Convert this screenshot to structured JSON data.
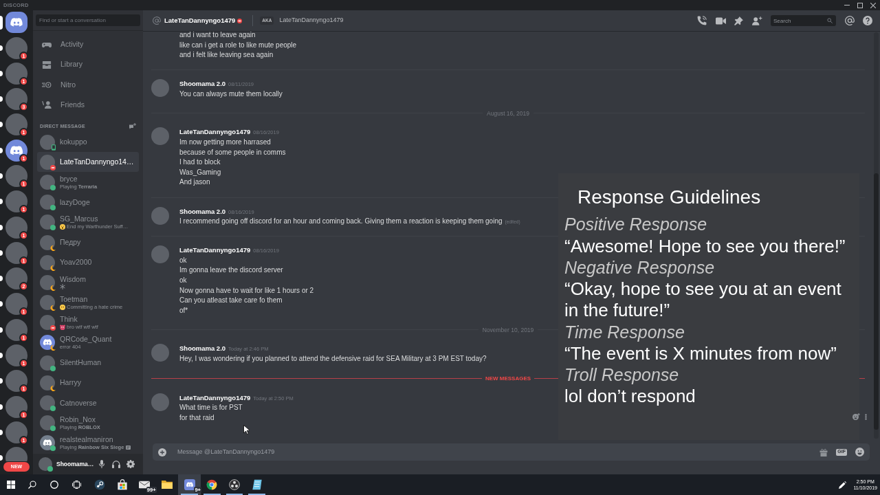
{
  "title_bar": {
    "title": "DISCORD"
  },
  "home": {
    "selected": true
  },
  "servers": [
    {
      "avatar": {
        "kind": "photo"
      },
      "badge": "1",
      "unread": true,
      "selected": false
    },
    {
      "avatar": {
        "kind": "photo"
      },
      "badge": "1",
      "unread": true,
      "selected": false
    },
    {
      "avatar": {
        "kind": "photo"
      },
      "badge": "3",
      "unread": true,
      "selected": false
    },
    {
      "avatar": {
        "kind": "photo"
      },
      "badge": "1",
      "unread": true,
      "selected": false
    },
    {
      "avatar": {
        "kind": "default",
        "color": "#7289da"
      },
      "badge": "1",
      "unread": true,
      "selected": false
    },
    {
      "avatar": {
        "kind": "photo"
      },
      "badge": "1",
      "unread": true,
      "selected": false
    },
    {
      "avatar": {
        "kind": "photo"
      },
      "badge": "1",
      "unread": true,
      "selected": false
    },
    {
      "avatar": {
        "kind": "photo"
      },
      "badge": "1",
      "unread": true,
      "selected": false
    },
    {
      "avatar": {
        "kind": "photo"
      },
      "badge": "1",
      "unread": true,
      "selected": false
    },
    {
      "avatar": {
        "kind": "photo"
      },
      "badge": "2",
      "unread": true,
      "selected": false
    },
    {
      "avatar": {
        "kind": "photo"
      },
      "badge": "1",
      "unread": true,
      "selected": false
    },
    {
      "avatar": {
        "kind": "photo"
      },
      "badge": "1",
      "unread": true,
      "selected": false
    },
    {
      "avatar": {
        "kind": "photo"
      },
      "badge": "1",
      "unread": true,
      "selected": false
    },
    {
      "avatar": {
        "kind": "photo"
      },
      "badge": "1",
      "unread": true,
      "selected": false
    },
    {
      "avatar": {
        "kind": "photo"
      },
      "badge": "1",
      "unread": true,
      "selected": false
    },
    {
      "avatar": {
        "kind": "photo"
      },
      "badge": "1",
      "unread": true,
      "selected": false
    },
    {
      "avatar": {
        "kind": "photo"
      },
      "unread": true,
      "selected": false
    }
  ],
  "new_pill": "NEW",
  "sidebar": {
    "search": {
      "placeholder": "Find or start a conversation"
    },
    "nav": [
      {
        "label": "Activity"
      },
      {
        "label": "Library"
      },
      {
        "label": "Nitro"
      },
      {
        "label": "Friends"
      }
    ],
    "section_title": "DIRECT MESSAGE",
    "conversations": [
      {
        "name": "kokuppo",
        "avatar": {
          "kind": "photo"
        },
        "status": {
          "kind": "mobile"
        },
        "selected": false,
        "rich_presence": false
      },
      {
        "name": "LateTanDannyngo14…",
        "avatar": {
          "kind": "photo"
        },
        "status": {
          "kind": "dnd"
        },
        "selected": true,
        "rich_presence": false
      },
      {
        "name": "bryce",
        "activity": "Playing **Terraria**",
        "avatar": {
          "kind": "photo"
        },
        "status": {
          "kind": "online"
        },
        "selected": false,
        "rich_presence": false
      },
      {
        "name": "lazyDoge",
        "avatar": {
          "kind": "photo"
        },
        "status": {
          "kind": "online"
        },
        "selected": false,
        "rich_presence": false
      },
      {
        "name": "SG_Marcus",
        "emoji": {
          "kind": "scream"
        },
        "activity": "End my Warthunder Suff…",
        "avatar": {
          "kind": "photo"
        },
        "status": {
          "kind": "online"
        },
        "selected": false,
        "rich_presence": false
      },
      {
        "name": "Педру",
        "avatar": {
          "kind": "photo"
        },
        "status": {
          "kind": "idle"
        },
        "selected": false,
        "rich_presence": false
      },
      {
        "name": "Yoav2000",
        "avatar": {
          "kind": "photo"
        },
        "status": {
          "kind": "idle"
        },
        "selected": false,
        "rich_presence": false
      },
      {
        "name": "Wisdom",
        "emoji": {
          "kind": "snowflake"
        },
        "avatar": {
          "kind": "photo"
        },
        "status": {
          "kind": "idle"
        },
        "selected": false,
        "rich_presence": false
      },
      {
        "name": "Toetman",
        "emoji": {
          "kind": "blank-face"
        },
        "activity": "Committing a hate crime",
        "avatar": {
          "kind": "photo"
        },
        "status": {
          "kind": "idle"
        },
        "selected": false,
        "rich_presence": false
      },
      {
        "name": "Think",
        "emoji": {
          "kind": "monkey"
        },
        "activity": "bro wtf wtf wtf",
        "avatar": {
          "kind": "photo"
        },
        "status": {
          "kind": "dnd"
        },
        "selected": false,
        "rich_presence": false
      },
      {
        "name": "QRCode_Quant",
        "activity": "error 404",
        "avatar": {
          "kind": "default",
          "color": "#7289da"
        },
        "status": {
          "kind": "idle"
        },
        "selected": false,
        "rich_presence": false
      },
      {
        "name": "SilentHuman",
        "avatar": {
          "kind": "photo"
        },
        "status": {
          "kind": "online"
        },
        "selected": false,
        "rich_presence": false
      },
      {
        "name": "Harryy",
        "avatar": {
          "kind": "photo"
        },
        "status": {
          "kind": "idle"
        },
        "selected": false,
        "rich_presence": false
      },
      {
        "name": "Catnoverse",
        "avatar": {
          "kind": "photo"
        },
        "status": {
          "kind": "online"
        },
        "selected": false,
        "rich_presence": false
      },
      {
        "name": "Robin_Nox",
        "activity": "Playing **ROBLOX**",
        "avatar": {
          "kind": "photo"
        },
        "status": {
          "kind": "online"
        },
        "selected": false,
        "rich_presence": false
      },
      {
        "name": "realstealmaniron",
        "activity": "Playing **Rainbow Six Siege**",
        "avatar": {
          "kind": "default",
          "color": "#747f8d"
        },
        "status": {
          "kind": "online"
        },
        "selected": false,
        "rich_presence": true
      }
    ]
  },
  "user_panel": {
    "name": "Shoomama…",
    "status": {
      "kind": "online"
    }
  },
  "header": {
    "name": "LateTanDannyngo1479",
    "status": {
      "kind": "dnd"
    },
    "aka_label": "AKA",
    "aka_name": "LateTanDannyngo1479",
    "search": {
      "placeholder": "Search"
    }
  },
  "messages": [
    {
      "kind": "continuation",
      "lines": [
        "and i want to leave again",
        "like can i get a role to like mute people",
        "and i felt like leaving sea again"
      ]
    },
    {
      "kind": "message",
      "author": "Shoomama 2.0",
      "timestamp": "08/11/2019",
      "lines": [
        "You can always mute them locally"
      ]
    },
    {
      "kind": "date_divider",
      "text": "August 16, 2019"
    },
    {
      "kind": "message",
      "author": "LateTanDannyngo1479",
      "timestamp": "08/16/2019",
      "lines": [
        "Im now getting more harrased",
        "because of some people in comms",
        "I had to block",
        "Was_Gaming",
        "And jason"
      ]
    },
    {
      "kind": "message",
      "author": "Shoomama 2.0",
      "timestamp": "08/16/2019",
      "lines": [
        "I recommend going off discord for an hour and coming back. Giving them a reaction is keeping them going"
      ],
      "edited_label": "(edited)"
    },
    {
      "kind": "message",
      "author": "LateTanDannyngo1479",
      "timestamp": "08/16/2019",
      "lines": [
        "ok",
        "Im gonna leave the discord server",
        "ok",
        "Now gonna have to wait for like 1 hours or 2",
        "Can you atleast take care fo them",
        "of*"
      ]
    },
    {
      "kind": "date_divider",
      "text": "November 10, 2019"
    },
    {
      "kind": "message",
      "author": "Shoomama 2.0",
      "timestamp": "Today at 2:46 PM",
      "lines": [
        "Hey, I was wondering if you planned to attend the defensive raid for SEA Military at 3 PM EST today?"
      ]
    },
    {
      "kind": "new_divider",
      "text": "NEW MESSAGES"
    },
    {
      "kind": "message",
      "author": "LateTanDannyngo1479",
      "timestamp": "Today at 2:50 PM",
      "lines": [
        "What time is for PST",
        "for that raid"
      ]
    }
  ],
  "composer": {
    "placeholder": "Message @LateTanDannyngo1479",
    "gif_label": "GIF"
  },
  "overlay": {
    "title": "Response Guidelines",
    "items": [
      {
        "heading": "Positive Response",
        "response": "“Awesome! Hope to see you there!”"
      },
      {
        "heading": "Negative Response",
        "response": "“Okay, hope to see you at an event in the future!”"
      },
      {
        "heading": "Time Response",
        "response": "“The event is X minutes from now”"
      },
      {
        "heading": "Troll Response",
        "response": "lol don’t respond"
      }
    ]
  },
  "taskbar": {
    "apps": [
      {
        "selected": false,
        "running": false
      },
      {
        "selected": false,
        "running": false
      },
      {
        "selected": false,
        "running": false,
        "badge": "99+"
      },
      {
        "selected": false,
        "running": false
      },
      {
        "selected": true,
        "running": true,
        "badge": "9+"
      },
      {
        "selected": false,
        "running": true
      },
      {
        "selected": false,
        "running": true
      },
      {
        "selected": false,
        "running": true
      }
    ],
    "time": "2:50 PM",
    "date": "11/10/2019"
  }
}
